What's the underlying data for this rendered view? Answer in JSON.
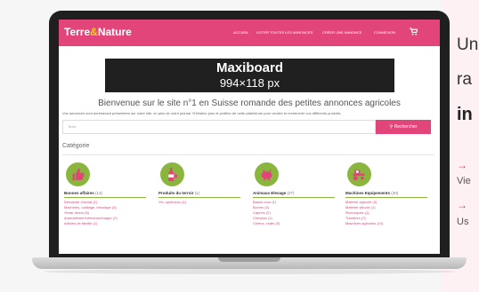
{
  "promo": {
    "line1": "Un",
    "line2": "ra",
    "line3": "in",
    "arrow1": "→",
    "sub1": "Vie",
    "arrow2": "→",
    "sub2": "Us"
  },
  "site": {
    "logo_left": "Terre",
    "logo_amp": "&",
    "logo_right": "Nature",
    "nav": [
      "ACCUEIL",
      "LISTER TOUTES LES ANNONCES",
      "CRÉER UNE ANNONCE",
      "CONNEXION"
    ],
    "cart_icon": "cart-icon",
    "banner_title": "Maxiboard",
    "banner_size": "994×118 px",
    "welcome": "Bienvenue sur le site n°1 en Suisse romande des petites annonces agricoles",
    "subtitle": "Vos annonces sont dorénavant présentées sur notre site, en plus de notre journal. N'hésitez plus et profitez de cette plateforme pour vendre et rechercher vos différents produits.",
    "search_placeholder": "Texte",
    "search_button": "Rechercher",
    "category_title": "Catégorie",
    "accent": "#e2457a",
    "green": "#8ab63e"
  },
  "categories": [
    {
      "icon": "thumbs-up-icon",
      "title": "Bonnes affaires",
      "count": "(13)",
      "items": [
        "Demande d'achat (1)",
        "Machines, outillage, bricolage (3)",
        "Vente divers (6)",
        "Ameublement-électroménager (2)",
        "Articles de famille (1)"
      ]
    },
    {
      "icon": "wine-bottle-icon",
      "title": "Produits du terroir",
      "count": "(1)",
      "items": [
        "Vin, spiritueux (1)"
      ]
    },
    {
      "icon": "pig-icon",
      "title": "Animaux Elevage",
      "count": "(27)",
      "items": [
        "Basse-cour (1)",
        "Bovins (3)",
        "Caprins (2)",
        "Chevaux (1)",
        "Chiens, chats (5)"
      ]
    },
    {
      "icon": "tractor-icon",
      "title": "Machines Equipements",
      "count": "(20)",
      "items": [
        "Matériel agricole (3)",
        "Matériel viticole (1)",
        "Remorques (1)",
        "Tracteurs (7)",
        "Machines agricoles (10)"
      ]
    }
  ]
}
